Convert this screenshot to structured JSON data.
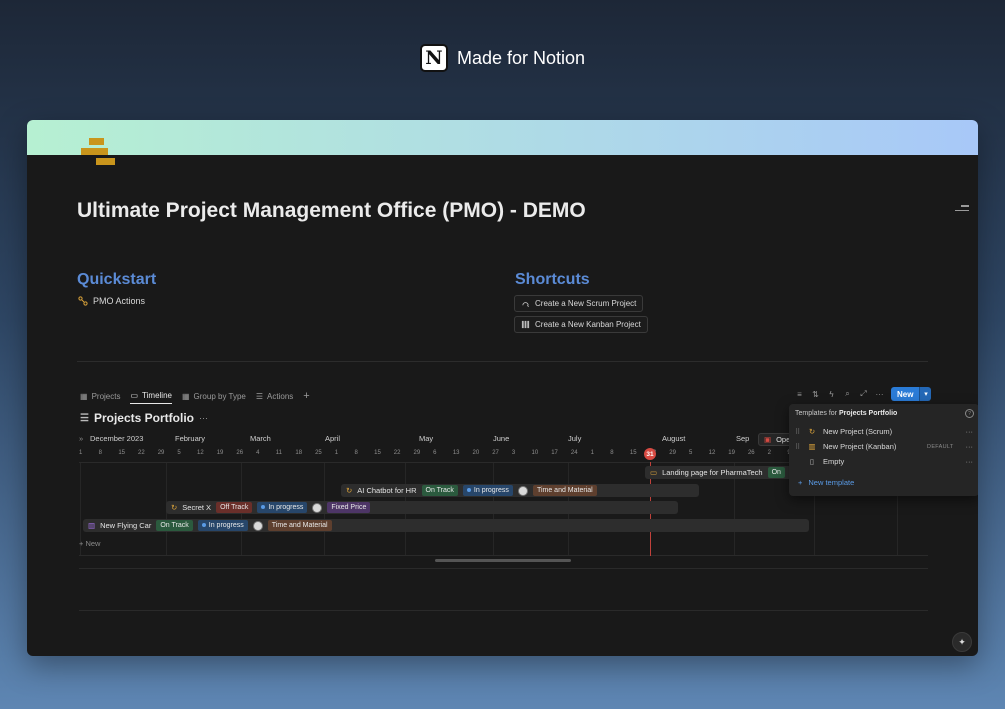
{
  "brand": {
    "text": "Made for Notion",
    "logo_letter": "N"
  },
  "page": {
    "title": "Ultimate Project Management Office (PMO) - DEMO"
  },
  "quickstart": {
    "heading": "Quickstart",
    "link": "PMO Actions"
  },
  "shortcuts": {
    "heading": "Shortcuts",
    "items": [
      "Create a New Scrum Project",
      "Create a New Kanban Project"
    ]
  },
  "tabs": [
    "Projects",
    "Timeline",
    "Group by Type",
    "Actions"
  ],
  "active_tab": "Timeline",
  "toolbar": {
    "new_label": "New"
  },
  "database": {
    "title": "Projects Portfolio"
  },
  "timeline": {
    "months": [
      "December 2023",
      "February",
      "March",
      "April",
      "May",
      "June",
      "July",
      "August",
      "Sep"
    ],
    "days": [
      "1",
      "8",
      "15",
      "22",
      "29",
      "5",
      "12",
      "19",
      "26",
      "4",
      "11",
      "18",
      "25",
      "1",
      "8",
      "15",
      "22",
      "29",
      "6",
      "13",
      "20",
      "27",
      "3",
      "10",
      "17",
      "24",
      "1",
      "8",
      "15",
      "22",
      "29",
      "5",
      "12",
      "19",
      "26",
      "2",
      "9",
      "16"
    ],
    "today": "31",
    "rows": {
      "pharmatech": {
        "name": "Landing page for PharmaTech",
        "status": "On"
      },
      "chatbot": {
        "name": "AI Chatbot for HR",
        "status": "On Track",
        "progress": "In progress",
        "billing": "Time and Material"
      },
      "secretx": {
        "name": "Secret X",
        "status": "Off Track",
        "progress": "In progress",
        "billing": "Fixed Price"
      },
      "flyingcar": {
        "name": "New Flying Car",
        "status": "On Track",
        "progress": "In progress",
        "billing": "Time and Material"
      }
    },
    "overflow_label": "Ope",
    "new_row": "New"
  },
  "templates_menu": {
    "prefix": "Templates for ",
    "target": "Projects Portfolio",
    "items": [
      {
        "label": "New Project (Scrum)",
        "badge": ""
      },
      {
        "label": "New Project (Kanban)",
        "badge": "DEFAULT"
      },
      {
        "label": "Empty",
        "badge": ""
      }
    ],
    "new_template": "New template"
  },
  "colors": {
    "accent": "#2a7bd6",
    "heading": "#5b8bd6",
    "today": "#d74a42"
  }
}
